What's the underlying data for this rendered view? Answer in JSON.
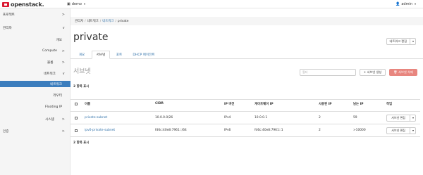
{
  "topbar": {
    "brand": "openstack.",
    "project": "demo",
    "user": "admin"
  },
  "sidebar": {
    "items": [
      {
        "label": "프로젝트",
        "chevron": ">"
      },
      {
        "label": "관리자",
        "chevron": "∨"
      },
      {
        "label": "개요",
        "chevron": ""
      },
      {
        "label": "Compute",
        "chevron": ">"
      },
      {
        "label": "볼륨",
        "chevron": ">"
      },
      {
        "label": "네트워크",
        "chevron": "∨"
      },
      {
        "label": "네트워크",
        "chevron": ""
      },
      {
        "label": "라우터",
        "chevron": ""
      },
      {
        "label": "Floating IP",
        "chevron": ""
      },
      {
        "label": "시스템",
        "chevron": ">"
      },
      {
        "label": "인증",
        "chevron": ">"
      }
    ]
  },
  "breadcrumb": {
    "items": [
      "관리자",
      "네트워크",
      "네트워크",
      "private"
    ]
  },
  "page": {
    "title": "private",
    "edit_network": "네트워크 편집"
  },
  "tabs": [
    "개요",
    "서브넷",
    "포트",
    "DHCP 에이전트"
  ],
  "subnets": {
    "section_title": "서브넷",
    "filter_placeholder": "필터",
    "create_button": "+ 서브넷 생성",
    "delete_button": "서브넷 삭제",
    "count_top": "2 항목 표시",
    "count_bottom": "2 항목 표시",
    "columns": [
      "이름",
      "CIDR",
      "IP 버전",
      "게이트웨이 IP",
      "사용된 IP",
      "남는 IP",
      "작업"
    ],
    "rows": [
      {
        "name": "private-subnet",
        "cidr": "10.0.0.0/26",
        "ip_version": "IPv4",
        "gateway": "10.0.0.1",
        "used": "2",
        "free": "59",
        "action": "서브넷 편집"
      },
      {
        "name": "ipv6-private-subnet",
        "cidr": "fd6c:40e8:7961::/64",
        "ip_version": "IPv6",
        "gateway": "fd6c:40e8:7961::1",
        "used": "2",
        "free": ">10000",
        "action": "서브넷 편집"
      }
    ]
  }
}
